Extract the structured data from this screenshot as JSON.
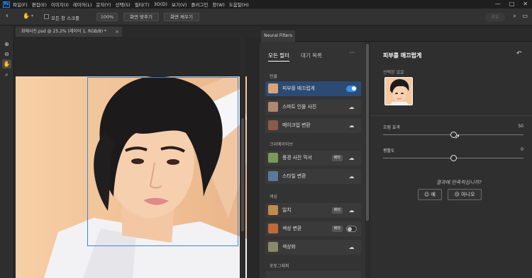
{
  "app": {
    "logo_text": "Ps",
    "menu": [
      "파일(F)",
      "편집(E)",
      "이미지(I)",
      "레이어(L)",
      "문자(Y)",
      "선택(S)",
      "필터(T)",
      "3D(D)",
      "보기(V)",
      "플러그인",
      "창(W)",
      "도움말(H)"
    ],
    "window_controls": [
      "—",
      "□",
      "✕"
    ]
  },
  "options_bar": {
    "scroll_all_label": "모든 창 스크롤",
    "zoom_value": "100%",
    "fit_screen_label": "화면 맞추기",
    "fill_screen_label": "화면 채우기",
    "share_label": "공유"
  },
  "document": {
    "tab_title": "화애사진.psd @ 25.2% (레이어 1, RGB/8) *",
    "close_glyph": "×"
  },
  "neural_filters": {
    "panel_tab": "Neural Filters",
    "subtabs": [
      "모든 필터",
      "대기 목록"
    ],
    "more_glyph": "···",
    "groups": [
      "인물",
      "크리에이티브",
      "색상",
      "포토그래피"
    ],
    "items": [
      {
        "label": "피부를 매끄럽게",
        "toggle": "on",
        "thumb": "#d9a47a"
      },
      {
        "label": "스마트 인물 사진",
        "cloud": true,
        "thumb": "#b08870"
      },
      {
        "label": "메이크업 변환",
        "cloud": true,
        "thumb": "#8a5a4a"
      },
      {
        "label": "풍경 사진 믹서",
        "badge": "베타",
        "cloud": true,
        "thumb": "#7a9a5a"
      },
      {
        "label": "스타일 변환",
        "cloud": true,
        "thumb": "#5a7a9a"
      },
      {
        "label": "일치",
        "badge": "베타",
        "cloud": true,
        "thumb": "#c08a50"
      },
      {
        "label": "색상 변환",
        "badge": "베타",
        "toggle": "off",
        "thumb": "#c06a3a"
      },
      {
        "label": "색상화",
        "cloud": true,
        "thumb": "#8a8a6a"
      }
    ]
  },
  "skin_panel": {
    "title": "피부를 매끄럽게",
    "selected_face_label": "선택된 얼굴",
    "sliders": [
      {
        "label": "흐림 효과",
        "value": "50",
        "position": 0.5
      },
      {
        "label": "평활도",
        "value": "0",
        "position": 0.5
      }
    ],
    "feedback_question": "결과에 만족하십니까?",
    "yes_label": "예",
    "no_label": "아니오"
  }
}
